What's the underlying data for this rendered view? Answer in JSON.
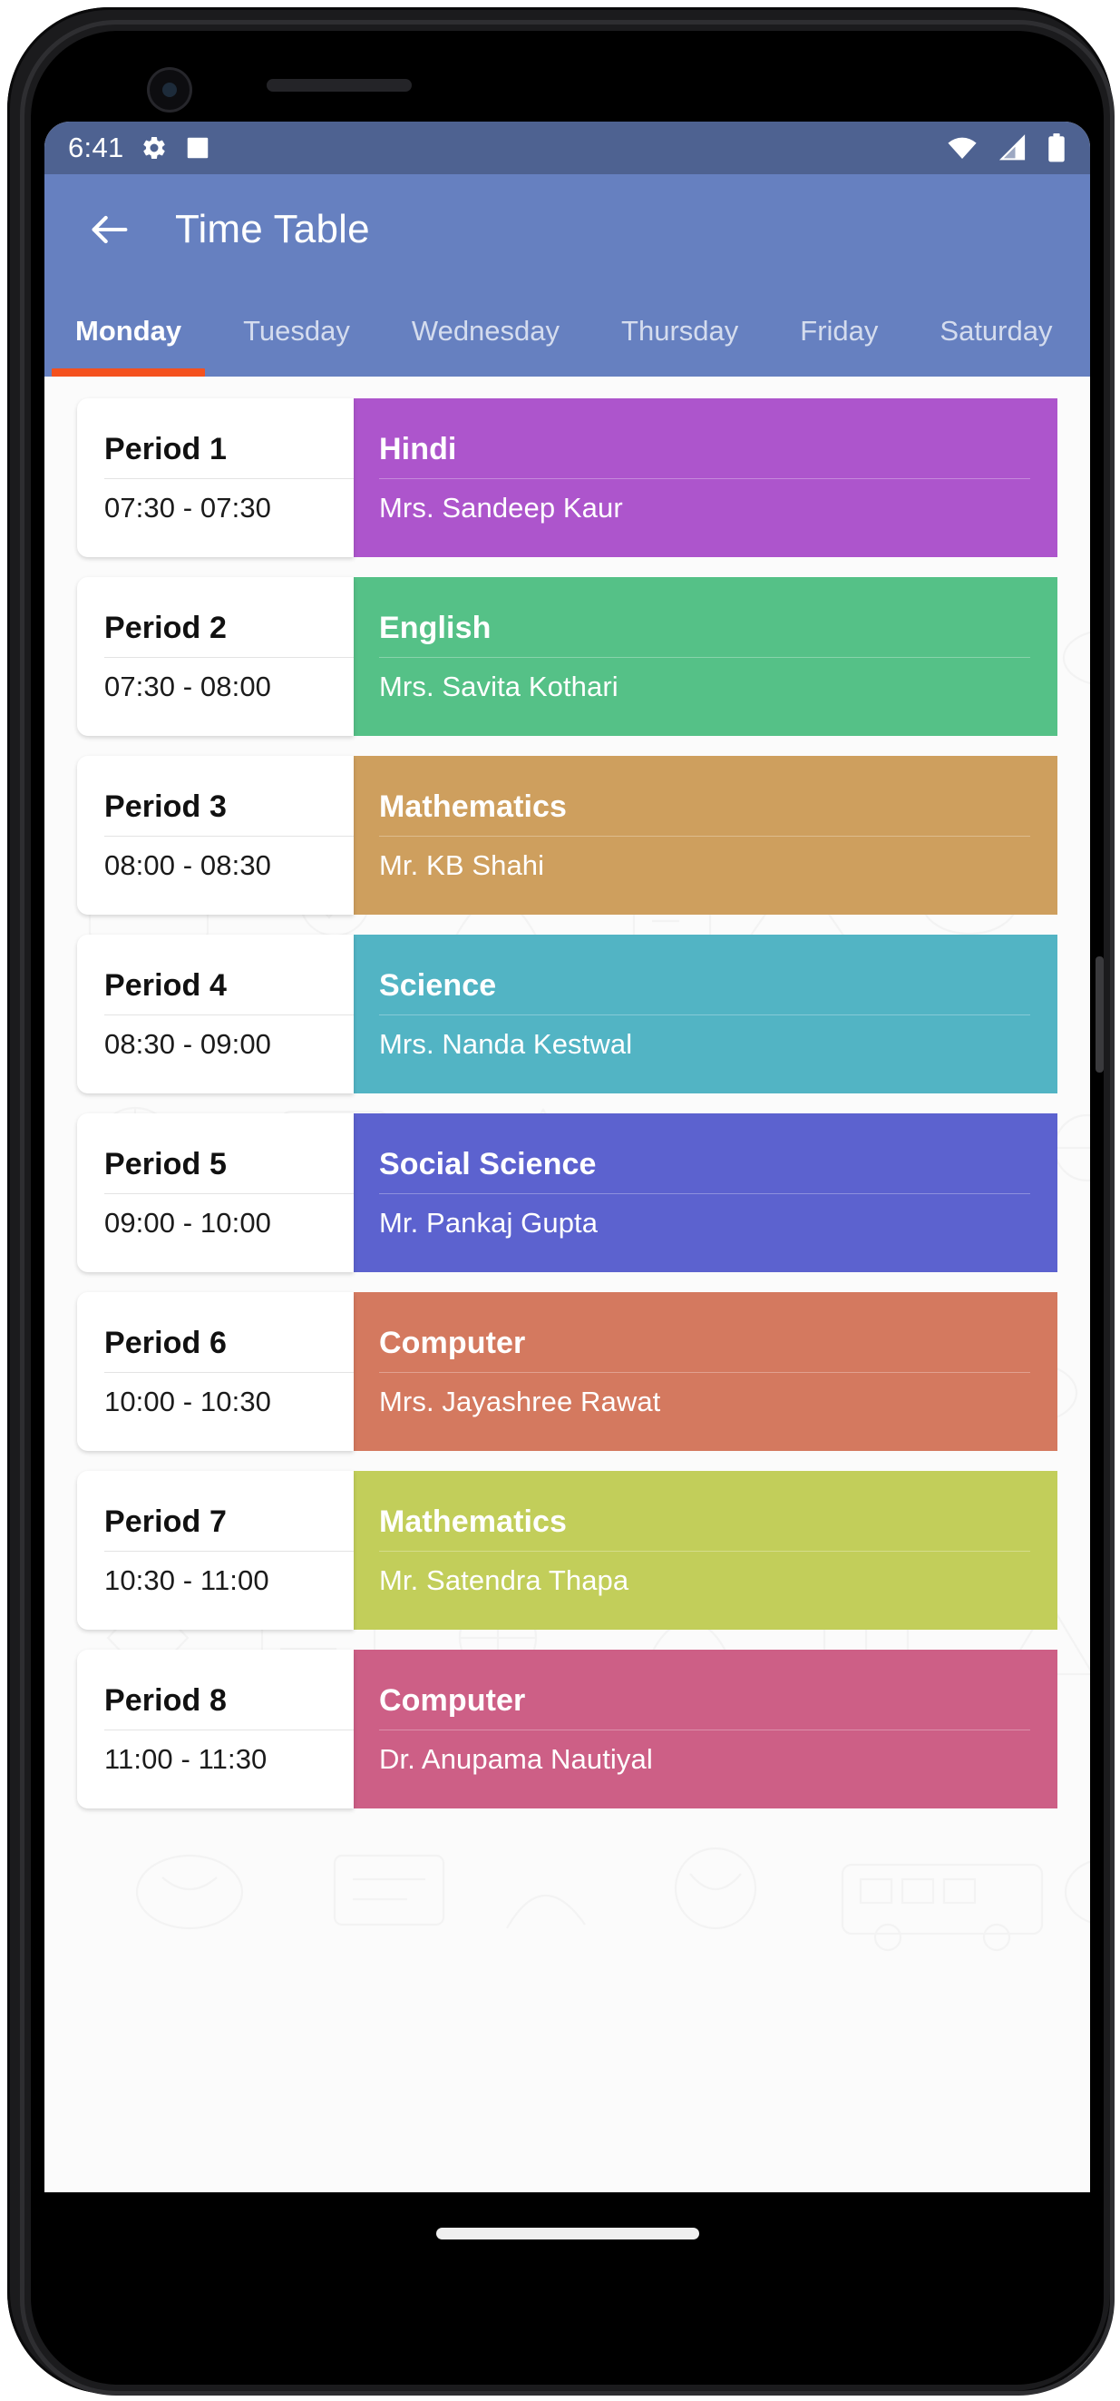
{
  "status_bar": {
    "clock": "6:41",
    "icons": [
      "gear-icon",
      "app-notification-icon",
      "wifi-icon",
      "cellular-signal-icon",
      "battery-icon"
    ]
  },
  "app_bar": {
    "back_label": "←",
    "title": "Time Table"
  },
  "tabs": {
    "active_index": 0,
    "items": [
      {
        "label": "Monday"
      },
      {
        "label": "Tuesday"
      },
      {
        "label": "Wednesday"
      },
      {
        "label": "Thursday"
      },
      {
        "label": "Friday"
      },
      {
        "label": "Saturday"
      }
    ]
  },
  "colors": {
    "app_bar": "#6680c0",
    "status_bar": "#4e6291",
    "tab_indicator": "#f4511e",
    "page_background": "#fbfbfb"
  },
  "timetable": {
    "periods": [
      {
        "period": "Period 1",
        "time": "07:30 - 07:30",
        "subject": "Hindi",
        "teacher": "Mrs. Sandeep Kaur",
        "color": "#ad55cc"
      },
      {
        "period": "Period 2",
        "time": "07:30 - 08:00",
        "subject": "English",
        "teacher": "Mrs. Savita Kothari",
        "color": "#55c187"
      },
      {
        "period": "Period 3",
        "time": "08:00 - 08:30",
        "subject": "Mathematics",
        "teacher": "Mr. KB Shahi",
        "color": "#ce9f5e"
      },
      {
        "period": "Period 4",
        "time": "08:30 - 09:00",
        "subject": "Science",
        "teacher": "Mrs. Nanda Kestwal",
        "color": "#52b4c4"
      },
      {
        "period": "Period 5",
        "time": "09:00 - 10:00",
        "subject": "Social Science",
        "teacher": "Mr. Pankaj Gupta",
        "color": "#5c62cf"
      },
      {
        "period": "Period 6",
        "time": "10:00 - 10:30",
        "subject": "Computer",
        "teacher": "Mrs. Jayashree Rawat",
        "color": "#d4795f"
      },
      {
        "period": "Period 7",
        "time": "10:30 - 11:00",
        "subject": "Mathematics",
        "teacher": "Mr. Satendra Thapa",
        "color": "#c2ce5a"
      },
      {
        "period": "Period 8",
        "time": "11:00 - 11:30",
        "subject": "Computer",
        "teacher": "Dr. Anupama Nautiyal",
        "color": "#cd5f86"
      }
    ]
  }
}
